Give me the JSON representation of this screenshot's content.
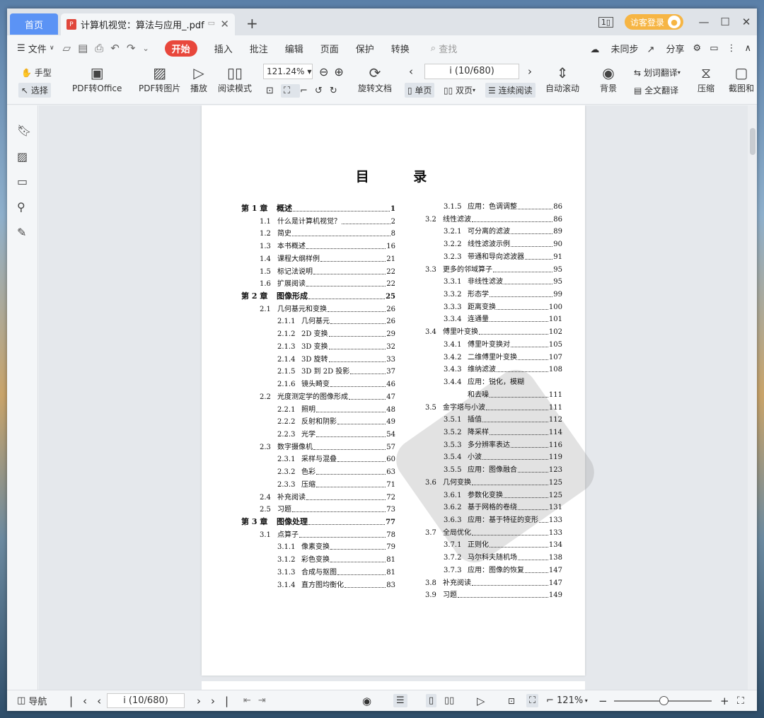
{
  "tabs": {
    "home": "首页",
    "doc": "计算机视觉：算法与应用_.pdf"
  },
  "window": {
    "login": "访客登录"
  },
  "menu": {
    "file": "文件",
    "start": "开始",
    "insert": "插入",
    "annotate": "批注",
    "edit": "编辑",
    "page": "页面",
    "protect": "保护",
    "convert": "转换",
    "search": "查找",
    "sync": "未同步",
    "share": "分享"
  },
  "ribbon": {
    "hand": "手型",
    "select": "选择",
    "pdf_office": "PDF转Office",
    "pdf_image": "PDF转图片",
    "play": "播放",
    "read_mode": "阅读模式",
    "zoom": "121.24%",
    "rotate": "旋转文档",
    "page_indicator": "i (10/680)",
    "single": "单页",
    "double": "双页",
    "continuous": "连续阅读",
    "auto_scroll": "自动滚动",
    "background": "背景",
    "word_translate": "划词翻译",
    "full_translate": "全文翻译",
    "compress": "压缩",
    "screenshot": "截图和"
  },
  "document": {
    "title": "目  录",
    "left_col": [
      {
        "num": "第 1 章",
        "text": "概述",
        "page": "1",
        "level": 0
      },
      {
        "num": "1.1",
        "text": "什么是计算机视觉？",
        "page": "2",
        "level": 1
      },
      {
        "num": "1.2",
        "text": "简史",
        "page": "8",
        "level": 1
      },
      {
        "num": "1.3",
        "text": "本书概述",
        "page": "16",
        "level": 1
      },
      {
        "num": "1.4",
        "text": "课程大纲样例",
        "page": "21",
        "level": 1
      },
      {
        "num": "1.5",
        "text": "标记法说明",
        "page": "22",
        "level": 1
      },
      {
        "num": "1.6",
        "text": "扩展阅读",
        "page": "22",
        "level": 1
      },
      {
        "num": "第 2 章",
        "text": "图像形成",
        "page": "25",
        "level": 0
      },
      {
        "num": "2.1",
        "text": "几何基元和变换",
        "page": "26",
        "level": 1
      },
      {
        "num": "2.1.1",
        "text": "几何基元",
        "page": "26",
        "level": 2
      },
      {
        "num": "2.1.2",
        "text": "2D 变换",
        "page": "29",
        "level": 2
      },
      {
        "num": "2.1.3",
        "text": "3D 变换",
        "page": "32",
        "level": 2
      },
      {
        "num": "2.1.4",
        "text": "3D 旋转",
        "page": "33",
        "level": 2
      },
      {
        "num": "2.1.5",
        "text": "3D 到 2D 投影",
        "page": "37",
        "level": 2
      },
      {
        "num": "2.1.6",
        "text": "镜头畸变",
        "page": "46",
        "level": 2
      },
      {
        "num": "2.2",
        "text": "光度测定学的图像形成",
        "page": "47",
        "level": 1
      },
      {
        "num": "2.2.1",
        "text": "照明",
        "page": "48",
        "level": 2
      },
      {
        "num": "2.2.2",
        "text": "反射和阴影",
        "page": "49",
        "level": 2
      },
      {
        "num": "2.2.3",
        "text": "光学",
        "page": "54",
        "level": 2
      },
      {
        "num": "2.3",
        "text": "数字摄像机",
        "page": "57",
        "level": 1
      },
      {
        "num": "2.3.1",
        "text": "采样与混叠",
        "page": "60",
        "level": 2
      },
      {
        "num": "2.3.2",
        "text": "色彩",
        "page": "63",
        "level": 2
      },
      {
        "num": "2.3.3",
        "text": "压缩",
        "page": "71",
        "level": 2
      },
      {
        "num": "2.4",
        "text": "补充阅读",
        "page": "72",
        "level": 1
      },
      {
        "num": "2.5",
        "text": "习题",
        "page": "73",
        "level": 1
      },
      {
        "num": "第 3 章",
        "text": "图像处理",
        "page": "77",
        "level": 0
      },
      {
        "num": "3.1",
        "text": "点算子",
        "page": "78",
        "level": 1
      },
      {
        "num": "3.1.1",
        "text": "像素变换",
        "page": "79",
        "level": 2
      },
      {
        "num": "3.1.2",
        "text": "彩色变换",
        "page": "81",
        "level": 2
      },
      {
        "num": "3.1.3",
        "text": "合成与抠图",
        "page": "81",
        "level": 2
      },
      {
        "num": "3.1.4",
        "text": "直方图均衡化",
        "page": "83",
        "level": 2
      }
    ],
    "right_col": [
      {
        "num": "3.1.5",
        "text": "应用：色调调整",
        "page": "86",
        "level": 2
      },
      {
        "num": "3.2",
        "text": "线性滤波",
        "page": "86",
        "level": 1
      },
      {
        "num": "3.2.1",
        "text": "可分离的滤波",
        "page": "89",
        "level": 2
      },
      {
        "num": "3.2.2",
        "text": "线性滤波示例",
        "page": "90",
        "level": 2
      },
      {
        "num": "3.2.3",
        "text": "带通和导向滤波器",
        "page": "91",
        "level": 2
      },
      {
        "num": "3.3",
        "text": "更多的邻域算子",
        "page": "95",
        "level": 1
      },
      {
        "num": "3.3.1",
        "text": "非线性滤波",
        "page": "95",
        "level": 2
      },
      {
        "num": "3.3.2",
        "text": "形态学",
        "page": "99",
        "level": 2
      },
      {
        "num": "3.3.3",
        "text": "距离变换",
        "page": "100",
        "level": 2
      },
      {
        "num": "3.3.4",
        "text": "连通量",
        "page": "101",
        "level": 2
      },
      {
        "num": "3.4",
        "text": "傅里叶变换",
        "page": "102",
        "level": 1
      },
      {
        "num": "3.4.1",
        "text": "傅里叶变换对",
        "page": "105",
        "level": 2
      },
      {
        "num": "3.4.2",
        "text": "二维傅里叶变换",
        "page": "107",
        "level": 2
      },
      {
        "num": "3.4.3",
        "text": "维纳滤波",
        "page": "108",
        "level": 2
      },
      {
        "num": "3.4.4",
        "text": "应用：锐化，模糊",
        "page": "",
        "level": 2
      },
      {
        "num": "",
        "text": "和去噪",
        "page": "111",
        "level": 2
      },
      {
        "num": "3.5",
        "text": "金字塔与小波",
        "page": "111",
        "level": 1
      },
      {
        "num": "3.5.1",
        "text": "插值",
        "page": "112",
        "level": 2
      },
      {
        "num": "3.5.2",
        "text": "降采样",
        "page": "114",
        "level": 2
      },
      {
        "num": "3.5.3",
        "text": "多分辨率表达",
        "page": "116",
        "level": 2
      },
      {
        "num": "3.5.4",
        "text": "小波",
        "page": "119",
        "level": 2
      },
      {
        "num": "3.5.5",
        "text": "应用：图像融合",
        "page": "123",
        "level": 2
      },
      {
        "num": "3.6",
        "text": "几何变换",
        "page": "125",
        "level": 1
      },
      {
        "num": "3.6.1",
        "text": "参数化变换",
        "page": "125",
        "level": 2
      },
      {
        "num": "3.6.2",
        "text": "基于网格的卷绕",
        "page": "131",
        "level": 2
      },
      {
        "num": "3.6.3",
        "text": "应用：基于特征的变形",
        "page": "133",
        "level": 2
      },
      {
        "num": "3.7",
        "text": "全局优化",
        "page": "133",
        "level": 1
      },
      {
        "num": "3.7.1",
        "text": "正则化",
        "page": "134",
        "level": 2
      },
      {
        "num": "3.7.2",
        "text": "马尔科夫随机场",
        "page": "138",
        "level": 2
      },
      {
        "num": "3.7.3",
        "text": "应用：图像的恢复",
        "page": "147",
        "level": 2
      },
      {
        "num": "3.8",
        "text": "补充阅读",
        "page": "147",
        "level": 1
      },
      {
        "num": "3.9",
        "text": "习题",
        "page": "149",
        "level": 1
      }
    ]
  },
  "status": {
    "nav": "导航",
    "page": "i (10/680)",
    "zoom": "121%"
  }
}
